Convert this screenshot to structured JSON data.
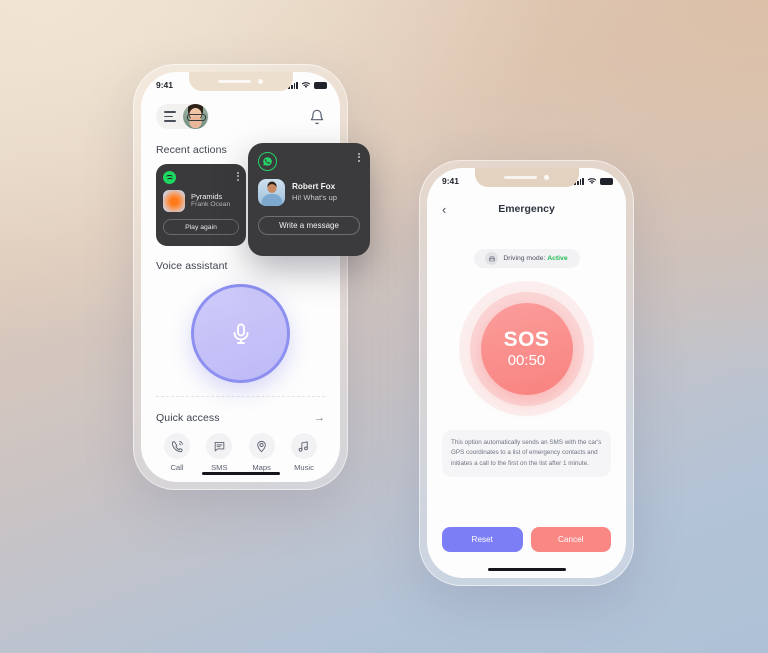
{
  "background": {
    "top_left": "#ecdfcd",
    "top_right": "#dcc0a8",
    "bottom": "#aec1d6"
  },
  "left_phone": {
    "status_bar": {
      "time": "9:41",
      "signal_icon": "cellular-bars-icon",
      "wifi_icon": "wifi-icon",
      "battery_icon": "battery-full-icon"
    },
    "top_bar": {
      "menu_icon": "hamburger-menu-icon",
      "avatar": "user-avatar",
      "notification_icon": "bell-icon"
    },
    "recent_actions": {
      "title": "Recent actions",
      "see_all_icon": "arrow-right-icon",
      "media_card": {
        "app_icon": "spotify-icon",
        "more_icon": "more-vertical-icon",
        "artwork": "album-artwork",
        "track": "Pyramids",
        "artist": "Frank Ocean",
        "action_label": "Play again"
      }
    },
    "voice_assistant": {
      "title": "Voice assistant",
      "mic_icon": "microphone-icon",
      "ring_color": "#8d90f1",
      "fill_color": "#c5c1f7"
    },
    "quick_access": {
      "title": "Quick access",
      "see_all_icon": "arrow-right-icon",
      "items": [
        {
          "label": "Call",
          "icon": "phone-call-icon"
        },
        {
          "label": "SMS",
          "icon": "message-bubble-icon"
        },
        {
          "label": "Maps",
          "icon": "location-pin-icon"
        },
        {
          "label": "Music",
          "icon": "music-note-icon"
        }
      ]
    }
  },
  "whatsapp_popup": {
    "app_icon": "whatsapp-icon",
    "more_icon": "more-vertical-icon",
    "contact_avatar": "contact-avatar",
    "sender": "Robert Fox",
    "message": "Hi! What's up",
    "reply_label": "Write a message"
  },
  "right_phone": {
    "status_bar": {
      "time": "9:41",
      "signal_icon": "cellular-bars-icon",
      "wifi_icon": "wifi-icon",
      "battery_icon": "battery-full-icon"
    },
    "nav": {
      "back_icon": "chevron-left-icon",
      "title": "Emergency"
    },
    "driving_badge": {
      "icon": "car-icon",
      "label": "Driving mode:",
      "value": "Active",
      "value_color": "#22bb55"
    },
    "sos": {
      "label": "SOS",
      "timer": "00:50",
      "color": "#f8827f"
    },
    "info_text": "This option automatically sends an SMS with the car's GPS coordinates to a list of emergency contacts and initiates a call to the first on the list  after 1 minute.",
    "buttons": {
      "reset": "Reset",
      "reset_color": "#7b7ef5",
      "cancel": "Cancel",
      "cancel_color": "#f98784"
    }
  }
}
